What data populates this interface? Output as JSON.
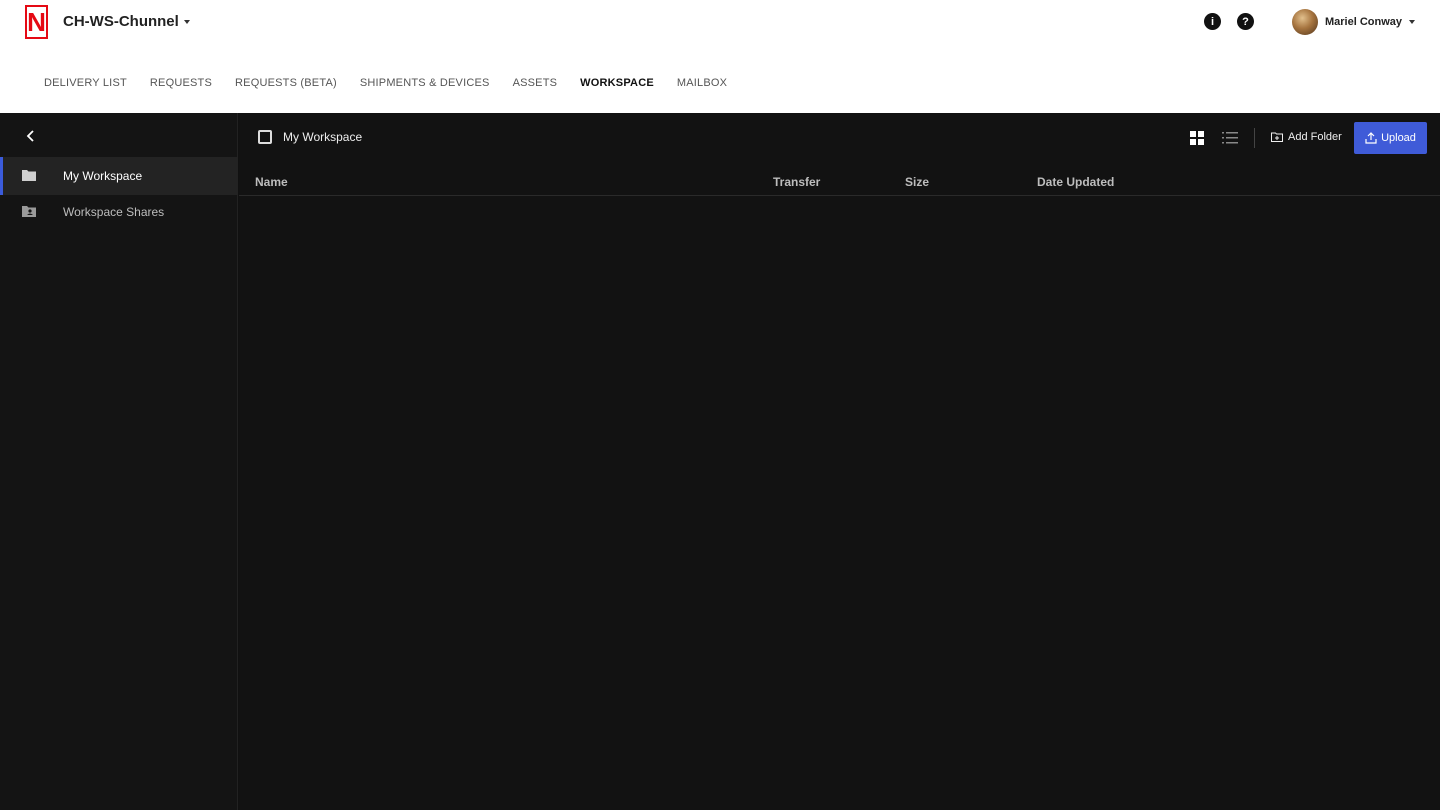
{
  "header": {
    "logo_letter": "N",
    "org_name": "CH-WS-Chunnel",
    "info_icon": "info-icon",
    "help_icon": "help-icon",
    "user_name": "Mariel Conway"
  },
  "nav": {
    "items": [
      {
        "label": "DELIVERY LIST"
      },
      {
        "label": "REQUESTS"
      },
      {
        "label": "REQUESTS (BETA)"
      },
      {
        "label": "SHIPMENTS & DEVICES"
      },
      {
        "label": "ASSETS"
      },
      {
        "label": "WORKSPACE"
      },
      {
        "label": "MAILBOX"
      }
    ],
    "active": "WORKSPACE"
  },
  "sidebar": {
    "items": [
      {
        "label": "My Workspace",
        "icon": "folder-icon"
      },
      {
        "label": "Workspace Shares",
        "icon": "shared-folder-icon"
      }
    ]
  },
  "main": {
    "title": "My Workspace",
    "add_folder_label": "Add Folder",
    "upload_label": "Upload",
    "columns": [
      "Name",
      "Transfer",
      "Size",
      "Date Updated"
    ],
    "rows": []
  },
  "colors": {
    "brand_red": "#e50914",
    "accent_blue": "#3f5bd8",
    "background": "#121212"
  }
}
